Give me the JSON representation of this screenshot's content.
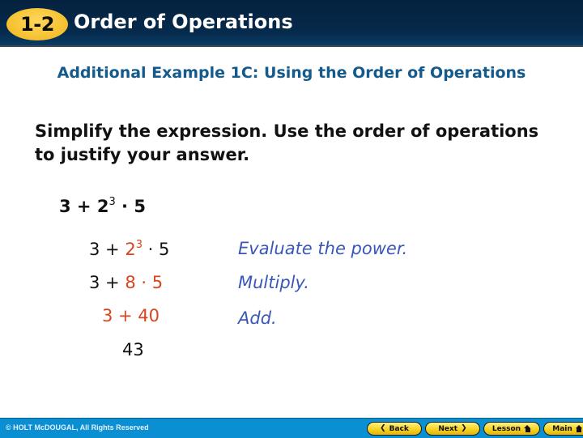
{
  "header": {
    "badge": "1-2",
    "title": "Order of Operations"
  },
  "subtitle": "Additional Example 1C: Using the Order of Operations",
  "instructions": "Simplify the expression. Use the order of operations to justify your answer.",
  "problem": {
    "base_before": "3 + 2",
    "exponent": "3",
    "after": " · 5"
  },
  "steps": [
    {
      "prefix": "3 + ",
      "highlight_base": "2",
      "highlight_exp": "3",
      "suffix": " · 5",
      "reason": "Evaluate the power."
    },
    {
      "prefix": "3 + ",
      "highlight": "8 · 5",
      "reason": "Multiply."
    },
    {
      "highlight": "3 + 40",
      "reason": "Add."
    },
    {
      "result": "43"
    }
  ],
  "colors": {
    "highlight": "#d8451e",
    "reason": "#3a57b8",
    "subtitle": "#145a8c",
    "header_bg": "#062a4c",
    "footer_bg": "#0b8fd3",
    "badge": "#f4bf2e"
  },
  "footer": {
    "copyright": "© HOLT McDOUGAL, All Rights Reserved",
    "nav": {
      "back": "Back",
      "next": "Next",
      "lesson": "Lesson",
      "main": "Main"
    }
  }
}
